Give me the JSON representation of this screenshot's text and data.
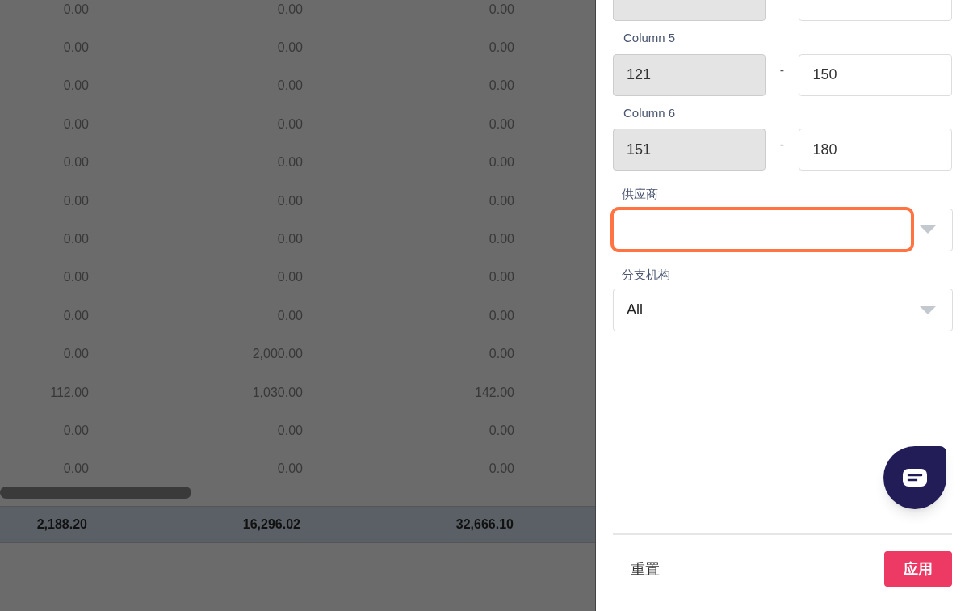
{
  "table": {
    "rows": [
      {
        "cells": [
          "0.00",
          "0.00",
          "0.00"
        ]
      },
      {
        "cells": [
          "0.00",
          "0.00",
          "0.00"
        ]
      },
      {
        "cells": [
          "0.00",
          "0.00",
          "0.00"
        ]
      },
      {
        "cells": [
          "0.00",
          "0.00",
          "0.00"
        ]
      },
      {
        "cells": [
          "0.00",
          "0.00",
          "0.00"
        ]
      },
      {
        "cells": [
          "0.00",
          "0.00",
          "0.00"
        ]
      },
      {
        "cells": [
          "0.00",
          "0.00",
          "0.00"
        ]
      },
      {
        "cells": [
          "0.00",
          "0.00",
          "0.00"
        ]
      },
      {
        "cells": [
          "0.00",
          "0.00",
          "0.00"
        ]
      },
      {
        "cells": [
          "0.00",
          "2,000.00",
          "0.00"
        ]
      },
      {
        "cells": [
          "112.00",
          "1,030.00",
          "142.00"
        ]
      },
      {
        "cells": [
          "0.00",
          "0.00",
          "0.00"
        ]
      },
      {
        "cells": [
          "0.00",
          "0.00",
          "0.00"
        ]
      }
    ],
    "totals": [
      "2,188.20",
      "16,296.02",
      "32,666.10"
    ]
  },
  "filter_panel": {
    "cut_off_range_row": true,
    "ranges": [
      {
        "label": "Column 5",
        "from": "121",
        "to": "150"
      },
      {
        "label": "Column 6",
        "from": "151",
        "to": "180"
      }
    ],
    "separator": "-",
    "selects": [
      {
        "label": "供应商",
        "highlighted": true
      },
      {
        "label": "分支机构",
        "value": "All",
        "highlighted": false
      }
    ],
    "reset_button": "重置",
    "apply_button": "应用"
  }
}
